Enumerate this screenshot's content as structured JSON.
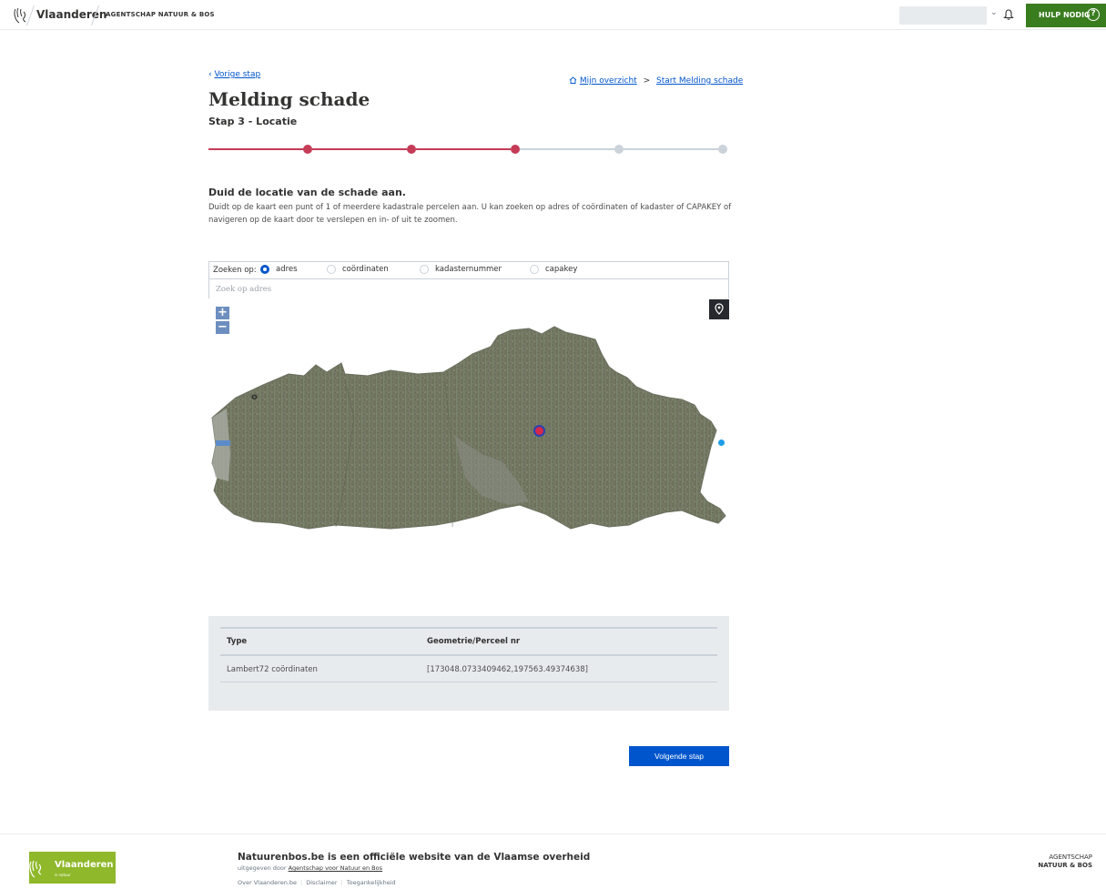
{
  "header": {
    "brand": "Vlaanderen",
    "agency": "AGENTSCHAP NATUUR & BOS",
    "help_label": "HULP NODIG"
  },
  "nav": {
    "back_label": "Vorige stap",
    "breadcrumb": [
      "Mijn overzicht",
      "Start Melding schade"
    ],
    "breadcrumb_sep": ">"
  },
  "page": {
    "title": "Melding schade",
    "step": "Stap 3 - Locatie"
  },
  "progress": {
    "total_steps": 5,
    "completed_steps": 3
  },
  "section": {
    "title": "Duid de locatie van de schade aan.",
    "text": "Duidt op de kaart een punt of 1 of meerdere kadastrale percelen aan. U kan zoeken op adres of coördinaten of kadaster of CAPAKEY of navigeren op de kaart door te verslepen en in- of uit te zoomen."
  },
  "search": {
    "label": "Zoeken op:",
    "options": [
      "adres",
      "coördinaten",
      "kadasternummer",
      "capakey"
    ],
    "selected": "adres",
    "placeholder": "Zoek op adres",
    "value": ""
  },
  "map": {
    "zoom_in": "+",
    "zoom_out": "−",
    "ghost_label": "o"
  },
  "table": {
    "headers": [
      "Type",
      "Geometrie/Perceel nr"
    ],
    "rows": [
      [
        "Lambert72 coördinaten",
        "[173048.0733409462,197563.49374638]"
      ]
    ]
  },
  "actions": {
    "next_label": "Volgende stap"
  },
  "footer": {
    "logo_name": "Vlaanderen",
    "logo_sub": "is natuur",
    "title": "Natuurenbos.be is een officiële website van de Vlaamse overheid",
    "published_prefix": "uitgegeven door",
    "published_link": "Agentschap voor Natuur en Bos",
    "links": [
      "Over Vlaanderen.be",
      "Disclaimer",
      "Toegankelijkheid"
    ],
    "agency_line1": "AGENTSCHAP",
    "agency_line2": "NATUUR & BOS"
  },
  "colors": {
    "accent": "#c53c57",
    "primary": "#0055cc",
    "help": "#3a7d1f",
    "footer_logo": "#8fb82a"
  }
}
